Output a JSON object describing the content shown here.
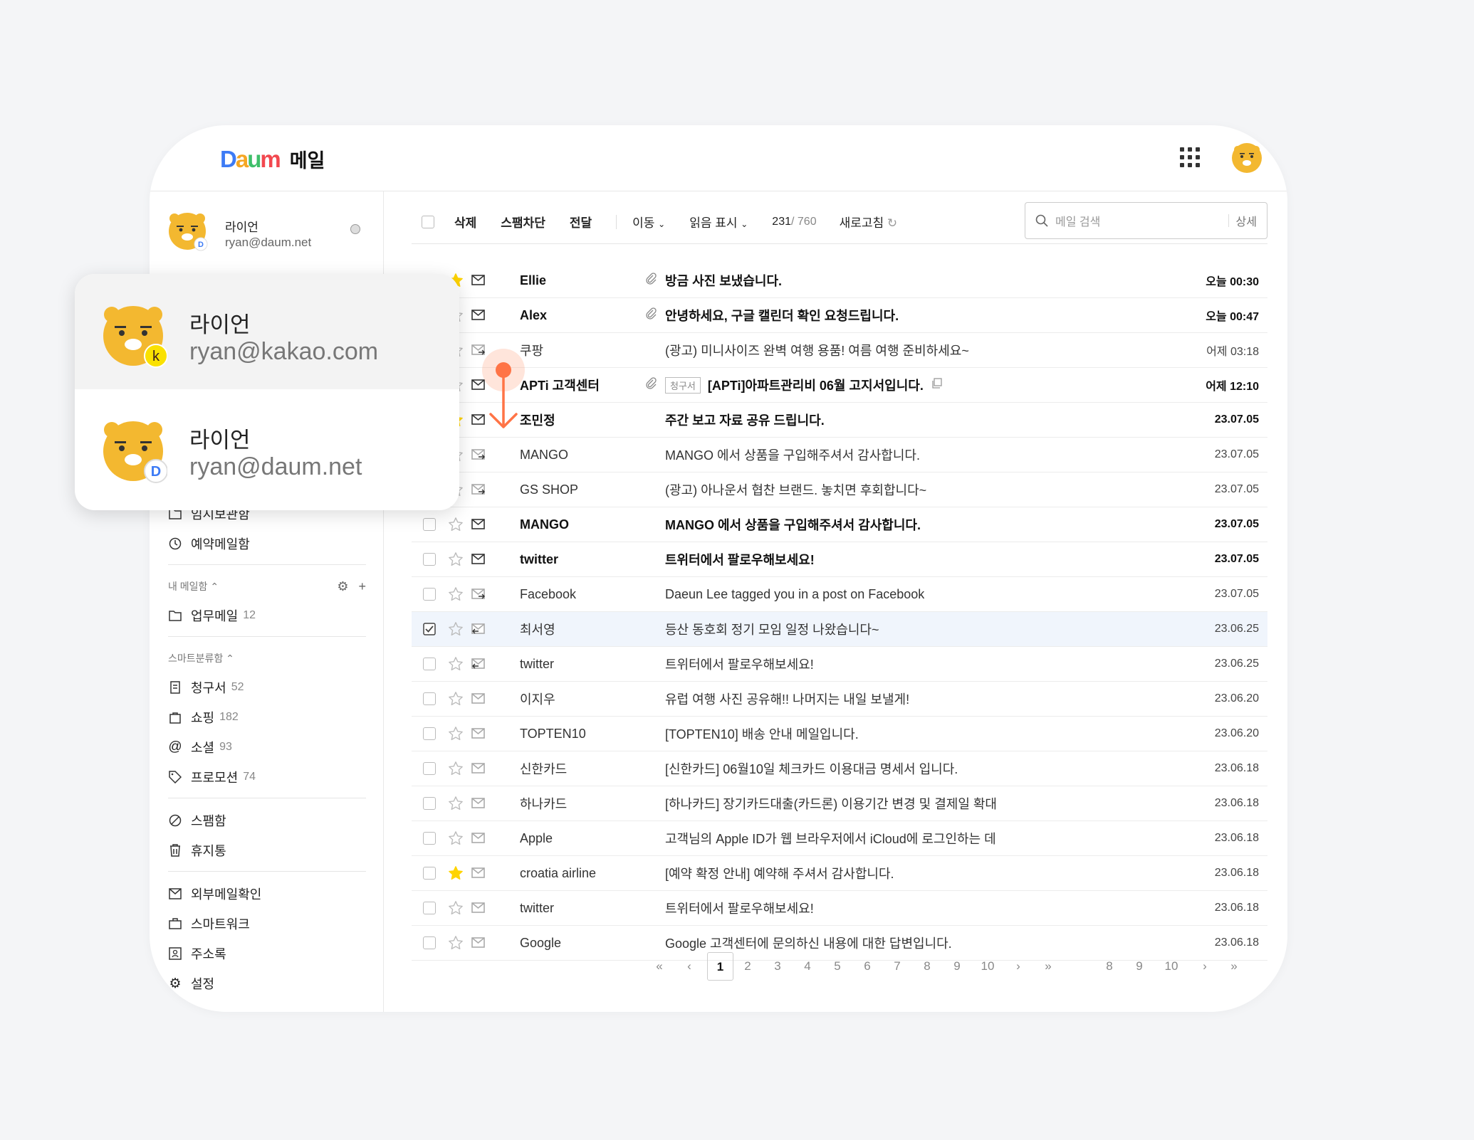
{
  "header": {
    "logo": "Daum",
    "service": "메일"
  },
  "account": {
    "name": "라이언",
    "email": "ryan@daum.net"
  },
  "account_switcher": [
    {
      "name": "라이언",
      "email": "ryan@kakao.com",
      "badge": "k"
    },
    {
      "name": "라이언",
      "email": "ryan@daum.net",
      "badge": "D"
    }
  ],
  "sidebar": {
    "mailboxes": [
      {
        "label": "임시보관함",
        "icon": "folder-icon"
      },
      {
        "label": "예약메일함",
        "icon": "clock-icon"
      }
    ],
    "my_mailbox": {
      "title": "내 메일함",
      "items": [
        {
          "label": "업무메일",
          "count": "12",
          "icon": "folder-icon"
        }
      ]
    },
    "smart": {
      "title": "스마트분류함",
      "items": [
        {
          "label": "청구서",
          "count": "52",
          "icon": "receipt-icon"
        },
        {
          "label": "쇼핑",
          "count": "182",
          "icon": "bag-icon"
        },
        {
          "label": "소셜",
          "count": "93",
          "icon": "at-icon"
        },
        {
          "label": "프로모션",
          "count": "74",
          "icon": "tag-icon"
        }
      ]
    },
    "system": [
      {
        "label": "스팸함",
        "icon": "spam-icon"
      },
      {
        "label": "휴지통",
        "icon": "trash-icon"
      }
    ],
    "tools": [
      {
        "label": "외부메일확인",
        "icon": "external-mail-icon"
      },
      {
        "label": "스마트워크",
        "icon": "briefcase-icon"
      },
      {
        "label": "주소록",
        "icon": "contacts-icon"
      },
      {
        "label": "설정",
        "icon": "gear-icon"
      }
    ]
  },
  "toolbar": {
    "delete": "삭제",
    "block_spam": "스팸차단",
    "forward": "전달",
    "move": "이동",
    "mark_read": "읽음 표시",
    "unread_count": "231",
    "total_count": "/ 760",
    "refresh": "새로고침"
  },
  "search": {
    "placeholder": "메일 검색",
    "detail": "상세"
  },
  "mails": [
    {
      "sender": "Ellie",
      "subject": "방금 사진 보냈습니다.",
      "date": "오늘 00:30",
      "attach": true,
      "star": true,
      "unread": true,
      "type": "read"
    },
    {
      "sender": "Alex",
      "subject": "안녕하세요, 구글 캘린더 확인 요청드립니다.",
      "date": "오늘 00:47",
      "attach": true,
      "star": false,
      "unread": true,
      "type": "read"
    },
    {
      "sender": "쿠팡",
      "subject": "(광고) 미니사이즈 완벽 여행 용품! 여름 여행 준비하세요~",
      "date": "어제 03:18",
      "attach": false,
      "star": false,
      "unread": false,
      "type": "fwd"
    },
    {
      "sender": "APTi 고객센터",
      "subject": "[APTi]아파트관리비 06월 고지서입니다.",
      "tag": "청구서",
      "date": "어제 12:10",
      "attach": true,
      "star": false,
      "unread": true,
      "type": "read"
    },
    {
      "sender": "조민정",
      "subject": "주간 보고 자료 공유 드립니다.",
      "date": "23.07.05",
      "attach": false,
      "star": true,
      "unread": true,
      "type": "read"
    },
    {
      "sender": "MANGO",
      "subject": "MANGO 에서 상품을 구입해주셔서 감사합니다.",
      "date": "23.07.05",
      "attach": false,
      "star": false,
      "unread": false,
      "type": "fwd"
    },
    {
      "sender": "GS SHOP",
      "subject": "(광고) 아나운서 협찬 브랜드. 놓치면 후회합니다~",
      "date": "23.07.05",
      "attach": false,
      "star": false,
      "unread": false,
      "type": "fwd"
    },
    {
      "sender": "MANGO",
      "subject": "MANGO 에서 상품을 구입해주셔서 감사합니다.",
      "date": "23.07.05",
      "attach": false,
      "star": false,
      "unread": true,
      "type": "read"
    },
    {
      "sender": "twitter",
      "subject": "트위터에서 팔로우해보세요!",
      "date": "23.07.05",
      "attach": false,
      "star": false,
      "unread": true,
      "type": "read"
    },
    {
      "sender": "Facebook",
      "subject": "Daeun Lee tagged you in a post on Facebook",
      "date": "23.07.05",
      "attach": false,
      "star": false,
      "unread": false,
      "type": "fwd"
    },
    {
      "sender": "최서영",
      "subject": "등산 동호회 정기 모임 일정 나왔습니다~",
      "date": "23.06.25",
      "attach": false,
      "star": false,
      "unread": false,
      "type": "reply",
      "selected": true
    },
    {
      "sender": "twitter",
      "subject": "트위터에서 팔로우해보세요!",
      "date": "23.06.25",
      "attach": false,
      "star": false,
      "unread": false,
      "type": "reply"
    },
    {
      "sender": "이지우",
      "subject": "유럽 여행 사진 공유해!! 나머지는 내일 보낼게!",
      "date": "23.06.20",
      "attach": false,
      "star": false,
      "unread": false,
      "type": "opened"
    },
    {
      "sender": "TOPTEN10",
      "subject": "[TOPTEN10] 배송 안내 메일입니다.",
      "date": "23.06.20",
      "attach": false,
      "star": false,
      "unread": false,
      "type": "opened"
    },
    {
      "sender": "신한카드",
      "subject": "[신한카드] 06월10일 체크카드 이용대금 명세서 입니다.",
      "date": "23.06.18",
      "attach": false,
      "star": false,
      "unread": false,
      "type": "opened"
    },
    {
      "sender": "하나카드",
      "subject": "[하나카드] 장기카드대출(카드론) 이용기간 변경 및 결제일 확대",
      "date": "23.06.18",
      "attach": false,
      "star": false,
      "unread": false,
      "type": "opened"
    },
    {
      "sender": "Apple",
      "subject": "고객님의 Apple ID가 웹 브라우저에서 iCloud에 로그인하는 데",
      "date": "23.06.18",
      "attach": false,
      "star": false,
      "unread": false,
      "type": "opened"
    },
    {
      "sender": "croatia airline",
      "subject": "[예약 확정 안내] 예약해 주셔서 감사합니다.",
      "date": "23.06.18",
      "attach": false,
      "star": true,
      "unread": false,
      "type": "opened"
    },
    {
      "sender": "twitter",
      "subject": "트위터에서 팔로우해보세요!",
      "date": "23.06.18",
      "attach": false,
      "star": false,
      "unread": false,
      "type": "opened"
    },
    {
      "sender": "Google",
      "subject": "Google 고객센터에 문의하신 내용에 대한 답변입니다.",
      "date": "23.06.18",
      "attach": false,
      "star": false,
      "unread": false,
      "type": "opened"
    }
  ],
  "pagination": {
    "first": "«",
    "prev": "‹",
    "next": "›",
    "last": "»",
    "pages": [
      "1",
      "2",
      "3",
      "4",
      "5",
      "6",
      "7",
      "8",
      "9",
      "10"
    ],
    "current": "1",
    "pages2": [
      "8",
      "9",
      "10"
    ]
  },
  "colors": {
    "accent": "#ff7446",
    "star": "#ffd400",
    "selected_row": "#f0f5fc"
  }
}
